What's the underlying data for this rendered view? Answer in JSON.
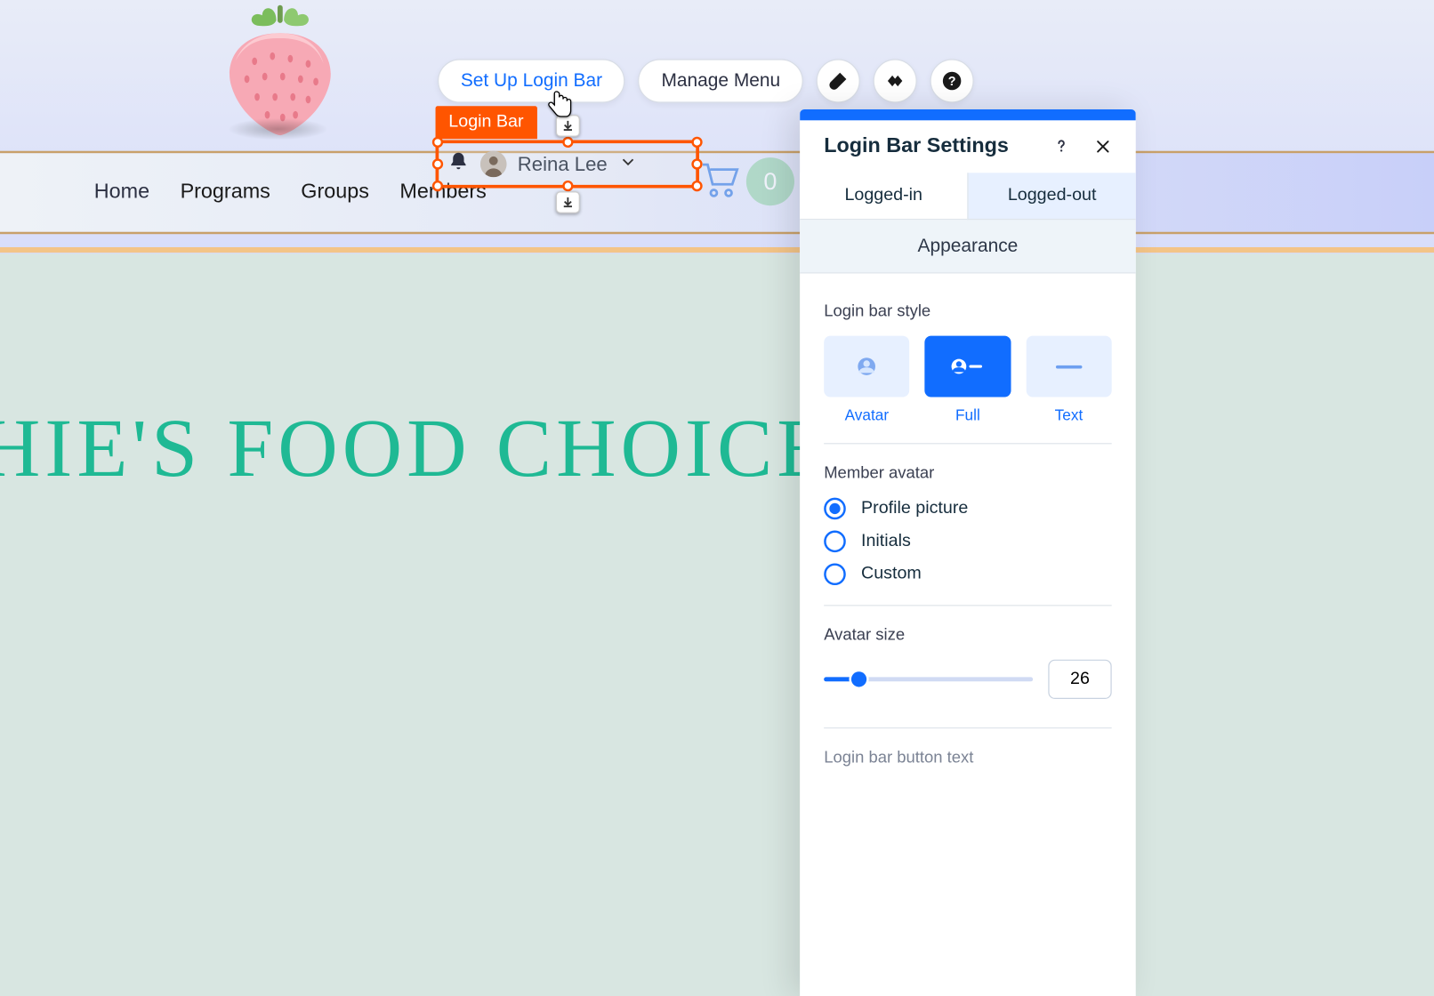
{
  "toolbar": {
    "set_up": "Set Up Login Bar",
    "manage": "Manage Menu"
  },
  "selection": {
    "tag": "Login Bar",
    "user_name": "Reina Lee"
  },
  "nav": {
    "items": [
      "Home",
      "Programs",
      "Groups",
      "Members"
    ]
  },
  "cart": {
    "count": "0"
  },
  "hero": {
    "title": "HIE'S FOOD CHOICE"
  },
  "panel": {
    "title": "Login Bar Settings",
    "tabs": {
      "active": "Logged-in",
      "inactive": "Logged-out"
    },
    "section": "Appearance",
    "login_bar_style": {
      "label": "Login bar style",
      "options": [
        {
          "id": "avatar",
          "label": "Avatar",
          "selected": false
        },
        {
          "id": "full",
          "label": "Full",
          "selected": true
        },
        {
          "id": "text",
          "label": "Text",
          "selected": false
        }
      ]
    },
    "member_avatar": {
      "label": "Member avatar",
      "options": [
        {
          "label": "Profile picture",
          "checked": true
        },
        {
          "label": "Initials",
          "checked": false
        },
        {
          "label": "Custom",
          "checked": false
        }
      ]
    },
    "avatar_size": {
      "label": "Avatar size",
      "value": "26"
    },
    "cut_off_label": "Login bar button text"
  }
}
